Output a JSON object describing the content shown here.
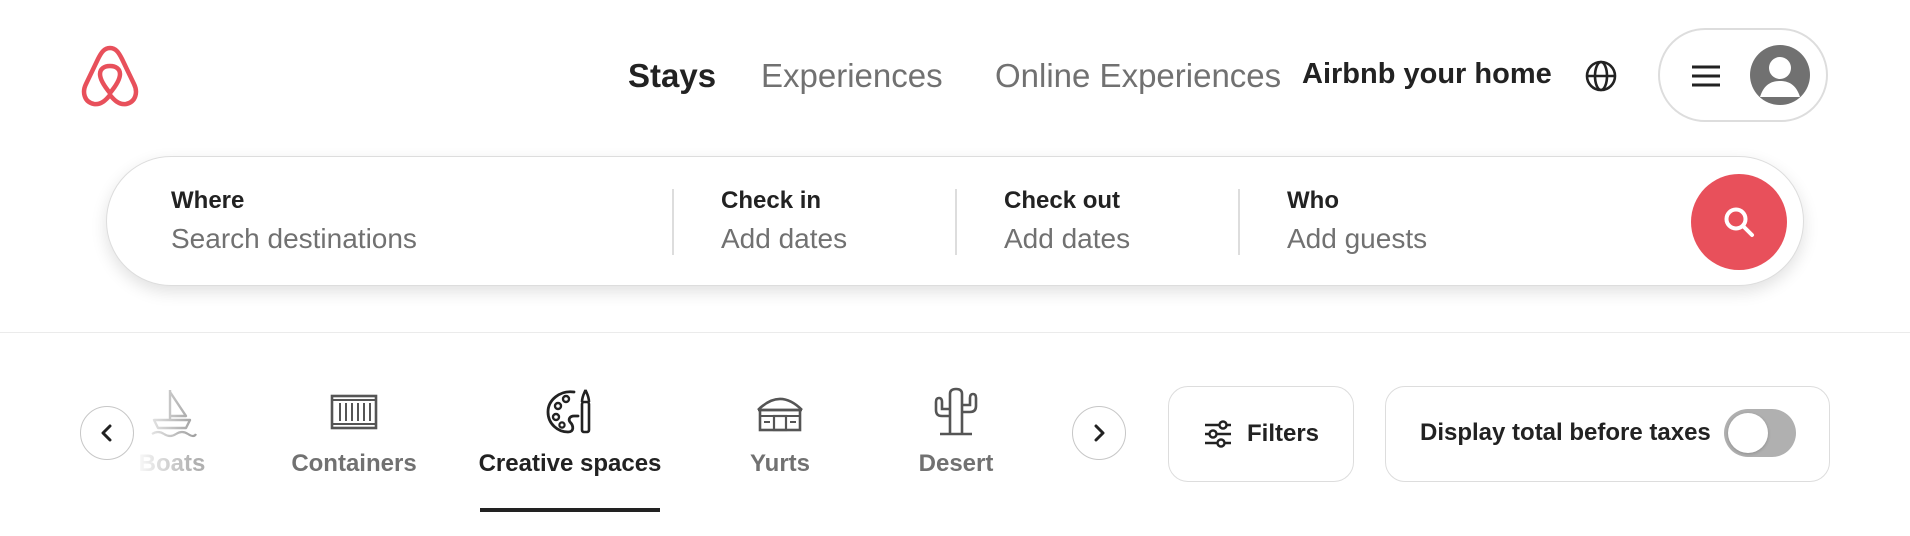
{
  "brand": {
    "logo": "airbnb-logo",
    "accent": "#E8505B"
  },
  "nav": {
    "items": [
      {
        "label": "Stays",
        "active": true
      },
      {
        "label": "Experiences",
        "active": false
      },
      {
        "label": "Online Experiences",
        "active": false
      }
    ],
    "host_link": "Airbnb your home",
    "globe_icon": "globe-icon",
    "menu_icon": "hamburger-menu-icon",
    "avatar_icon": "user-avatar-icon"
  },
  "search": {
    "where": {
      "title": "Where",
      "placeholder": "Search destinations"
    },
    "checkin": {
      "title": "Check in",
      "value": "Add dates"
    },
    "checkout": {
      "title": "Check out",
      "value": "Add dates"
    },
    "who": {
      "title": "Who",
      "value": "Add guests"
    },
    "button_icon": "search-icon"
  },
  "categories": {
    "items": [
      {
        "label": "Boats",
        "icon": "boat-icon",
        "active": false
      },
      {
        "label": "Containers",
        "icon": "container-icon",
        "active": false
      },
      {
        "label": "Creative spaces",
        "icon": "palette-icon",
        "active": true
      },
      {
        "label": "Yurts",
        "icon": "yurt-icon",
        "active": false
      },
      {
        "label": "Desert",
        "icon": "cactus-icon",
        "active": false
      }
    ],
    "prev_icon": "chevron-left-icon",
    "next_icon": "chevron-right-icon"
  },
  "filters": {
    "label": "Filters",
    "icon": "sliders-icon"
  },
  "taxes": {
    "label": "Display total before taxes",
    "enabled": false
  }
}
